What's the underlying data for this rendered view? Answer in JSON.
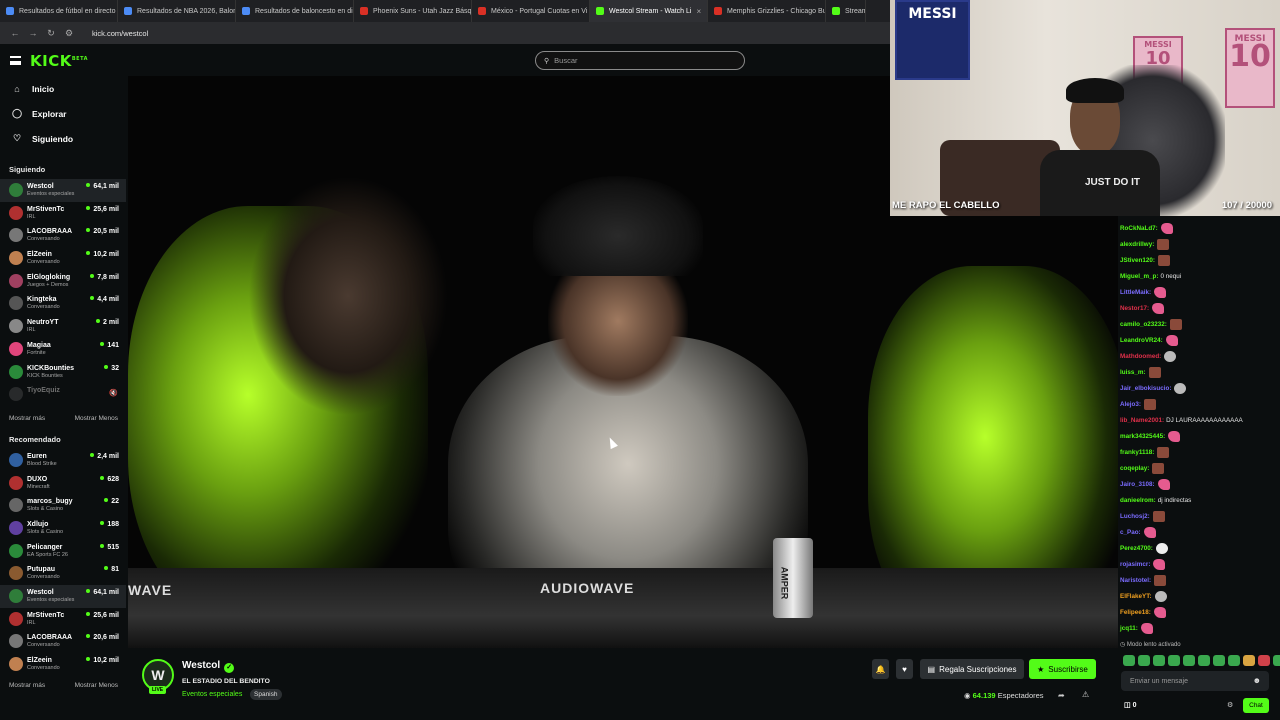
{
  "browser": {
    "tabs": [
      {
        "label": "Resultados de fútbol en directo",
        "color": "#4c8bf5"
      },
      {
        "label": "Resultados de NBA 2026, Balon",
        "color": "#4c8bf5"
      },
      {
        "label": "Resultados de baloncesto en dir",
        "color": "#4c8bf5"
      },
      {
        "label": "Phoenix Suns - Utah Jazz Básquet",
        "color": "#d93025"
      },
      {
        "label": "México - Portugal Cuotas en Vi",
        "color": "#d93025"
      },
      {
        "label": "Westcol Stream - Watch Li",
        "color": "#53fc18"
      },
      {
        "label": "Memphis Grizzlies - Chicago Bu",
        "color": "#d93025"
      },
      {
        "label": "Stream",
        "color": "#53fc18"
      }
    ],
    "url": "kick.com/westcol"
  },
  "topnav": {
    "logo": "KICK",
    "logo_sup": "BETA",
    "search_placeholder": "Buscar"
  },
  "sidebar": {
    "nav": [
      {
        "label": "Inicio",
        "icon": "home-icon"
      },
      {
        "label": "Explorar",
        "icon": "compass-icon"
      },
      {
        "label": "Siguiendo",
        "icon": "heart-icon"
      }
    ],
    "following_title": "Siguiendo",
    "following": [
      {
        "name": "Westcol",
        "game": "Eventos especiales",
        "viewers": "64,1 mil",
        "color": "#2f7d3a"
      },
      {
        "name": "MrStivenTc",
        "game": "IRL",
        "viewers": "25,6 mil",
        "color": "#b03030"
      },
      {
        "name": "LACOBRAAA",
        "game": "Conversando",
        "viewers": "20,5 mil",
        "color": "#777"
      },
      {
        "name": "ElZeein",
        "game": "Conversando",
        "viewers": "10,2 mil",
        "color": "#c08050"
      },
      {
        "name": "ElGlogloking",
        "game": "Juegos + Demos",
        "viewers": "7,8 mil",
        "color": "#a04060"
      },
      {
        "name": "Kingteka",
        "game": "Conversando",
        "viewers": "4,4 mil",
        "color": "#555"
      },
      {
        "name": "NeutroYT",
        "game": "IRL",
        "viewers": "2 mil",
        "color": "#888"
      },
      {
        "name": "Magiaa",
        "game": "Fortnite",
        "viewers": "141",
        "color": "#e0457b"
      },
      {
        "name": "KICKBounties",
        "game": "KICK Bounties",
        "viewers": "32",
        "color": "#2a8a3a"
      }
    ],
    "offline_channel": "TiyoEquiz",
    "show_more": "Mostrar más",
    "show_less": "Mostrar Menos",
    "recommended_title": "Recomendado",
    "recommended": [
      {
        "name": "Euren",
        "game": "Blood Strike",
        "viewers": "2,4 mil",
        "color": "#3060a0"
      },
      {
        "name": "DUXO",
        "game": "Minecraft",
        "viewers": "628",
        "color": "#b03030"
      },
      {
        "name": "marcos_bugy",
        "game": "Slots & Casino",
        "viewers": "22",
        "color": "#666"
      },
      {
        "name": "Xdlujo",
        "game": "Slots & Casino",
        "viewers": "188",
        "color": "#6040a0"
      },
      {
        "name": "Pelicanger",
        "game": "EA Sports FC 26",
        "viewers": "515",
        "color": "#2a8a3a"
      },
      {
        "name": "Putupau",
        "game": "Conversando",
        "viewers": "81",
        "color": "#8a5a30"
      },
      {
        "name": "Westcol",
        "game": "Eventos especiales",
        "viewers": "64,1 mil",
        "color": "#2f7d3a"
      },
      {
        "name": "MrStivenTc",
        "game": "IRL",
        "viewers": "25,6 mil",
        "color": "#b03030"
      },
      {
        "name": "LACOBRAAA",
        "game": "Conversando",
        "viewers": "20,6 mil",
        "color": "#777"
      },
      {
        "name": "ElZeein",
        "game": "Conversando",
        "viewers": "10,2 mil",
        "color": "#c08050"
      }
    ]
  },
  "webcam": {
    "caption": "ME RAPO EL CABELLO",
    "counter": "107 / 20000",
    "poster_text": "MESSI",
    "poster_number": "10",
    "shirt_text": "JUST DO IT"
  },
  "video_overlay": {
    "brand_left": "WAVE",
    "brand_center": "AUDIOWAVE",
    "brand_right": "AMPER"
  },
  "stream": {
    "avatar_letter": "W",
    "live_badge": "LIVE",
    "name": "Westcol",
    "title": "EL ESTADIO DEL BENDITO",
    "category": "Eventos especiales",
    "language": "Spanish",
    "gift_label": "Regala Suscripciones",
    "subscribe_label": "Suscribirse",
    "viewers": "64.139",
    "viewers_label": "Espectadores"
  },
  "chat": {
    "messages": [
      {
        "user": "RoCkNaLd7:",
        "text": "",
        "color": "#53fc18",
        "emote": "pink"
      },
      {
        "user": "alexdrillwy:",
        "text": "",
        "color": "#53fc18",
        "emote": "brown"
      },
      {
        "user": "JStiven120:",
        "text": "",
        "color": "#53fc18",
        "emote": "brown"
      },
      {
        "user": "Miguel_m_p:",
        "text": "0 nequi",
        "color": "#53fc18",
        "emote": ""
      },
      {
        "user": "LittleMaik:",
        "text": "",
        "color": "#7b6cff",
        "emote": "pink"
      },
      {
        "user": "Nestor17:",
        "text": "",
        "color": "#e0304a",
        "emote": "pink"
      },
      {
        "user": "camilo_o23232:",
        "text": "",
        "color": "#53fc18",
        "emote": "brown"
      },
      {
        "user": "LeandroVR24:",
        "text": "",
        "color": "#53fc18",
        "emote": "pink"
      },
      {
        "user": "Mathdoomed:",
        "text": "",
        "color": "#e0304a",
        "emote": "gray"
      },
      {
        "user": "luiss_m:",
        "text": "",
        "color": "#53fc18",
        "emote": "brown"
      },
      {
        "user": "Jair_elbokisucio:",
        "text": "",
        "color": "#7b6cff",
        "emote": "gray"
      },
      {
        "user": "Alejo3:",
        "text": "",
        "color": "#7b6cff",
        "emote": "brown"
      },
      {
        "user": "lib_Name2001:",
        "text": "DJ LAURAAAAAAAAAAAA",
        "color": "#e0304a",
        "emote": ""
      },
      {
        "user": "mark34325445:",
        "text": "",
        "color": "#53fc18",
        "emote": "pink"
      },
      {
        "user": "franky1118:",
        "text": "",
        "color": "#53fc18",
        "emote": "brown"
      },
      {
        "user": "coqeplay:",
        "text": "",
        "color": "#53fc18",
        "emote": "brown"
      },
      {
        "user": "Jairo_3108:",
        "text": "",
        "color": "#7b6cff",
        "emote": "pink"
      },
      {
        "user": "danieelrom:",
        "text": "dj indirectas",
        "color": "#53fc18",
        "emote": ""
      },
      {
        "user": "Luchosj2:",
        "text": "",
        "color": "#7b6cff",
        "emote": "brown"
      },
      {
        "user": "c_Pao:",
        "text": "",
        "color": "#7b6cff",
        "emote": "pink"
      },
      {
        "user": "Perez4700:",
        "text": "",
        "color": "#53fc18",
        "emote": "white"
      },
      {
        "user": "rojasimcr:",
        "text": "",
        "color": "#7b6cff",
        "emote": "pink"
      },
      {
        "user": "Naristotel:",
        "text": "",
        "color": "#7b6cff",
        "emote": "brown"
      },
      {
        "user": "ElFlakeYT:",
        "text": "",
        "color": "#f0a020",
        "emote": "gray"
      },
      {
        "user": "Felipee18:",
        "text": "",
        "color": "#f0a020",
        "emote": "pink"
      },
      {
        "user": "jcq11:",
        "text": "",
        "color": "#53fc18",
        "emote": "pink"
      }
    ],
    "slow_mode": "Modo lento activado",
    "input_placeholder": "Enviar un mensaje",
    "points": "0",
    "chat_button": "Chat"
  }
}
